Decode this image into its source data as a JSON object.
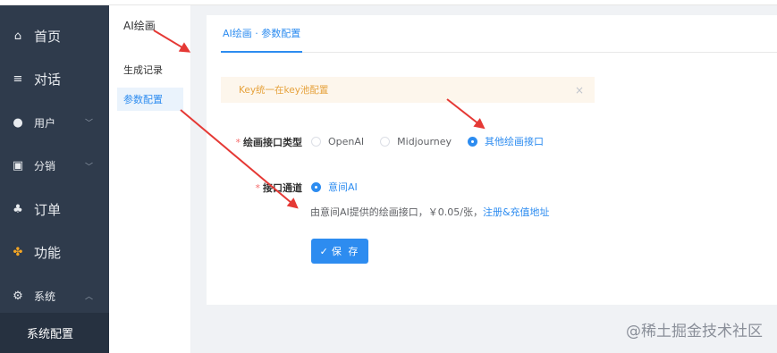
{
  "sidebar": {
    "items": [
      {
        "label": "首页",
        "icon": "home-icon",
        "glyph": "⌂"
      },
      {
        "label": "对话",
        "icon": "list-icon",
        "glyph": "≡"
      },
      {
        "label": "用户",
        "icon": "user-icon",
        "glyph": "●"
      },
      {
        "label": "分销",
        "icon": "share-icon",
        "glyph": "▣"
      },
      {
        "label": "订单",
        "icon": "money-bag-icon",
        "glyph": "♣"
      },
      {
        "label": "功能",
        "icon": "apps-icon",
        "glyph": "✤"
      },
      {
        "label": "系统",
        "icon": "settings-icon",
        "glyph": "⚙"
      }
    ],
    "sub_item": "系统配置"
  },
  "subnav": {
    "title": "AI绘画",
    "items": [
      "生成记录",
      "参数配置"
    ]
  },
  "tabs": {
    "active": "AI绘画 · 参数配置"
  },
  "alert": {
    "text": "Key统一在key池配置",
    "close": "×"
  },
  "form": {
    "type_label": "绘画接口类型",
    "type_options": [
      "OpenAI",
      "Midjourney",
      "其他绘画接口"
    ],
    "channel_label": "接口通道",
    "channel_option": "意间AI",
    "hint_text": "由意间AI提供的绘画接口，￥0.05/张，",
    "hint_link": "注册&充值地址",
    "save_label": "保 存",
    "save_icon": "✓"
  },
  "watermark": "@稀土掘金技术社区",
  "colors": {
    "primary": "#2d8cf0",
    "sidebar": "#2f3b4c",
    "alert_bg": "#fdf6ec",
    "arrow": "#e53935"
  }
}
